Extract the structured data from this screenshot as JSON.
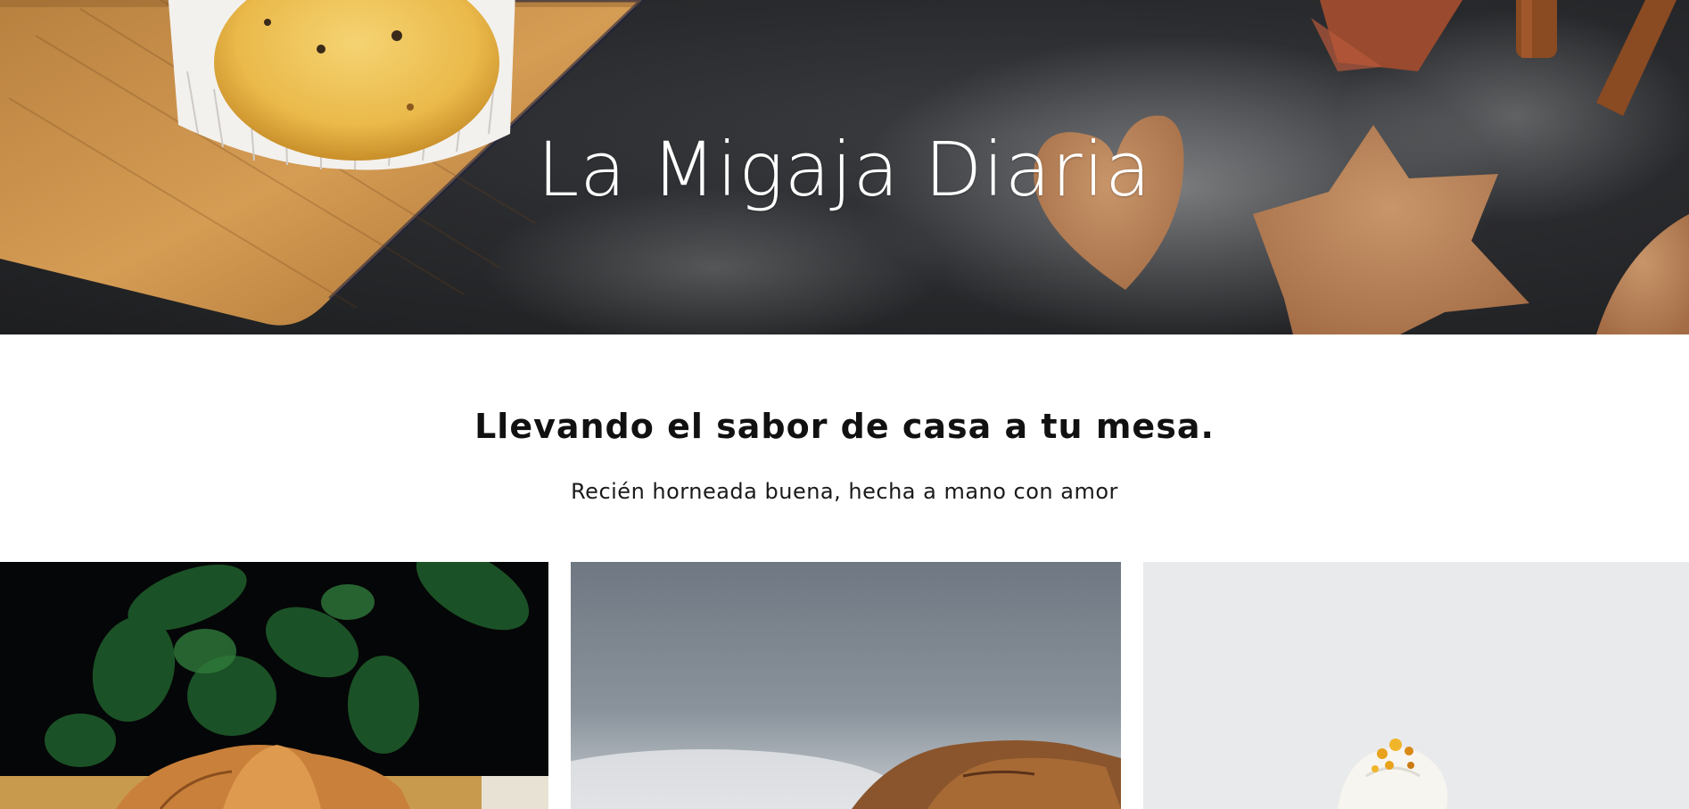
{
  "hero": {
    "title": "La Migaja Diaria",
    "background_color": "#2a2b2e",
    "decor": [
      "muffin-image",
      "cutting-board-image",
      "heart-cookie-image",
      "star-cookie-image",
      "cinnamon-sticks-image",
      "flour-dust"
    ]
  },
  "intro": {
    "tagline": "Llevando el sabor de casa a tu mesa.",
    "subtitle": "Recién horneada buena, hecha a mano con amor"
  },
  "gallery": {
    "items": [
      {
        "subject": "croissant-photo",
        "background": "#050607"
      },
      {
        "subject": "pastry-photo",
        "background": "#7d8790"
      },
      {
        "subject": "cupcake-photo",
        "background": "#e9eaec"
      }
    ]
  }
}
